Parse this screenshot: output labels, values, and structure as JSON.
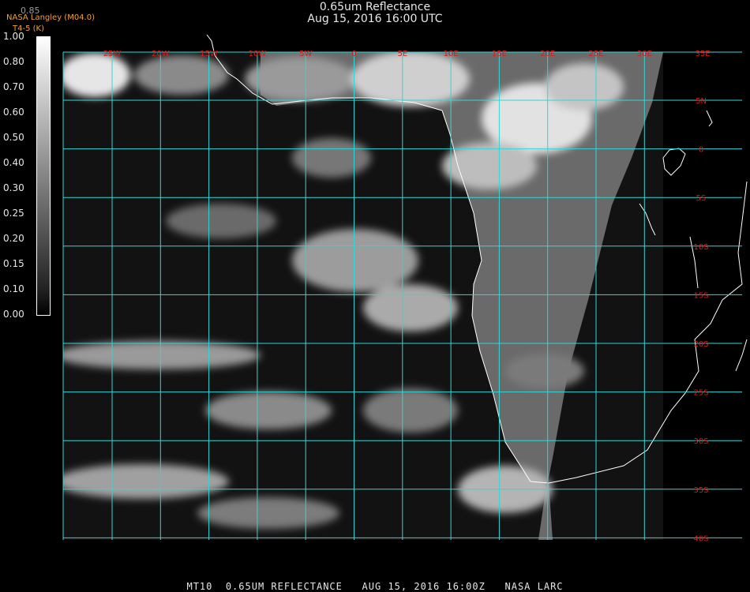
{
  "title": {
    "line1": "0.65um Reflectance",
    "line2": "Aug 15, 2016 16:00 UTC"
  },
  "header": {
    "org": "NASA Langley (M04.0)",
    "product": "T4-5 (K)",
    "top_value": "0.85"
  },
  "legend": {
    "ticks": [
      "1.00",
      "0.80",
      "0.70",
      "0.60",
      "0.50",
      "0.40",
      "0.30",
      "0.25",
      "0.20",
      "0.15",
      "0.10",
      "0.00"
    ],
    "grayscale": [
      "#ffffff",
      "#e8e8e8",
      "#d2d2d2",
      "#bcbcbc",
      "#a6a6a6",
      "#909090",
      "#7a7a7a",
      "#646464",
      "#4e4e4e",
      "#383838",
      "#222222",
      "#000000"
    ]
  },
  "map": {
    "longitude_labels": [
      "25W",
      "20W",
      "15W",
      "10W",
      "5W",
      "0",
      "5E",
      "10E",
      "15E",
      "20E",
      "25E",
      "30E",
      "35E"
    ],
    "latitude_labels": [
      "5N",
      "0",
      "5S",
      "10S",
      "15S",
      "20S",
      "25S",
      "30S",
      "35S",
      "40S"
    ],
    "grid_color": "#33d6d6",
    "label_color": "#e01818",
    "coast_color": "#ffffff"
  },
  "footer": "MT10  0.65UM REFLECTANCE   AUG 15, 2016 16:00Z   NASA LARC"
}
